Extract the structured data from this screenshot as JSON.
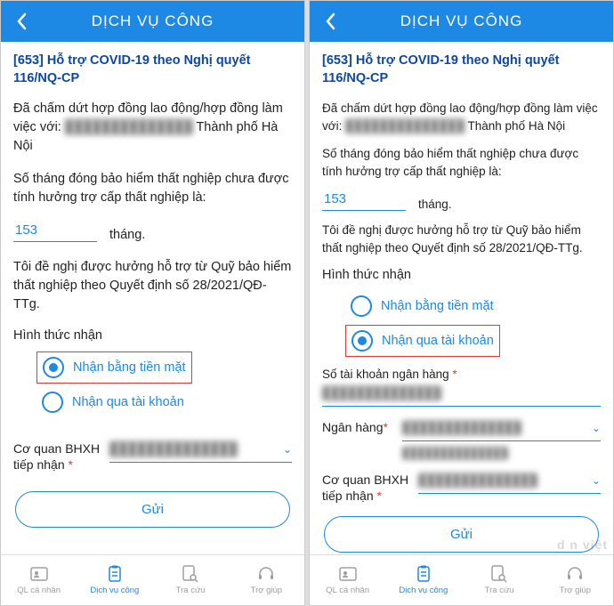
{
  "header": {
    "title": "DỊCH VỤ CÔNG"
  },
  "article_title": "[653] Hỗ trợ COVID-19 theo Nghị quyết 116/NQ-CP",
  "para1_prefix": "Đã chấm dứt hợp đồng  lao động/hợp đồng làm việc với: ",
  "para1_suffix": " Thành phố Hà Nội",
  "para2": "Số tháng đóng bảo hiểm thất nghiệp chưa được tính hưởng trợ cấp thất nghiệp là:",
  "months_value": "153",
  "months_unit": "tháng.",
  "para3": "Tôi đề nghị được hưởng hỗ trợ từ Quỹ bảo hiểm thất nghiệp theo Quyết định số 28/2021/QĐ-TTg.",
  "receive_label": "Hình thức nhận",
  "opt_cash": "Nhận bằng tiền mặt",
  "opt_bank": "Nhận qua tài khoản",
  "acct_label": "Số tài khoản ngân hàng ",
  "bank_label": "Ngân hàng",
  "agency_label1": "Cơ quan BHXH",
  "agency_label2": "tiếp nhận ",
  "submit": "Gửi",
  "tabs": {
    "t1": "QL cá nhân",
    "t2": "Dịch vụ công",
    "t3": "Tra cứu",
    "t4": "Trợ giúp"
  },
  "redacted": "██████████████",
  "watermark": "d n việt"
}
